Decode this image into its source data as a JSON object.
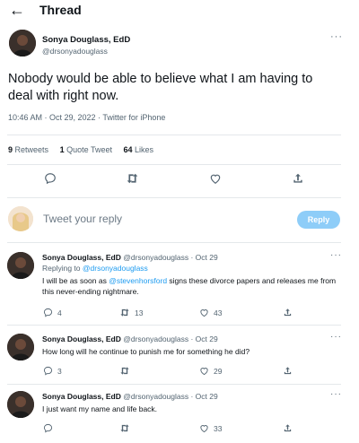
{
  "header": {
    "back_icon": "back-arrow-icon",
    "title": "Thread"
  },
  "main_tweet": {
    "author_name": "Sonya Douglass, EdD",
    "author_handle": "@drsonyadouglass",
    "text": "Nobody would be able to believe what I am having to deal with right now.",
    "meta": "10:46 AM · Oct 29, 2022 · Twitter for iPhone",
    "stats": {
      "retweets_count": "9",
      "retweets_label": "Retweets",
      "quotes_count": "1",
      "quotes_label": "Quote Tweet",
      "likes_count": "64",
      "likes_label": "Likes"
    }
  },
  "reply_box": {
    "placeholder": "Tweet your reply",
    "button_label": "Reply"
  },
  "replies": [
    {
      "name": "Sonya Douglass, EdD",
      "handle_date": "@drsonyadouglass · Oct 29",
      "replying_to_label": "Replying to",
      "replying_to_handle": "@drsonyadouglass",
      "text_before": "I will be as soon as ",
      "text_mention": "@stevenhorsford",
      "text_after": " signs these divorce papers and releases me from this never-ending nightmare.",
      "reply_count": "4",
      "retweet_count": "13",
      "like_count": "43"
    },
    {
      "name": "Sonya Douglass, EdD",
      "handle_date": "@drsonyadouglass · Oct 29",
      "text": "How long will he continue to punish me for something he did?",
      "reply_count": "3",
      "retweet_count": "",
      "like_count": "29"
    },
    {
      "name": "Sonya Douglass, EdD",
      "handle_date": "@drsonyadouglass · Oct 29",
      "text": "I just want my name and life back.",
      "reply_count": "",
      "retweet_count": "",
      "like_count": "33"
    }
  ],
  "colors": {
    "accent": "#1d9bf0",
    "reply_button": "#8ecdf8",
    "secondary_text": "#536471",
    "divider": "#e4e8eb"
  },
  "icons": [
    "back-arrow-icon",
    "more-icon",
    "reply-icon",
    "retweet-icon",
    "like-icon",
    "share-icon"
  ]
}
